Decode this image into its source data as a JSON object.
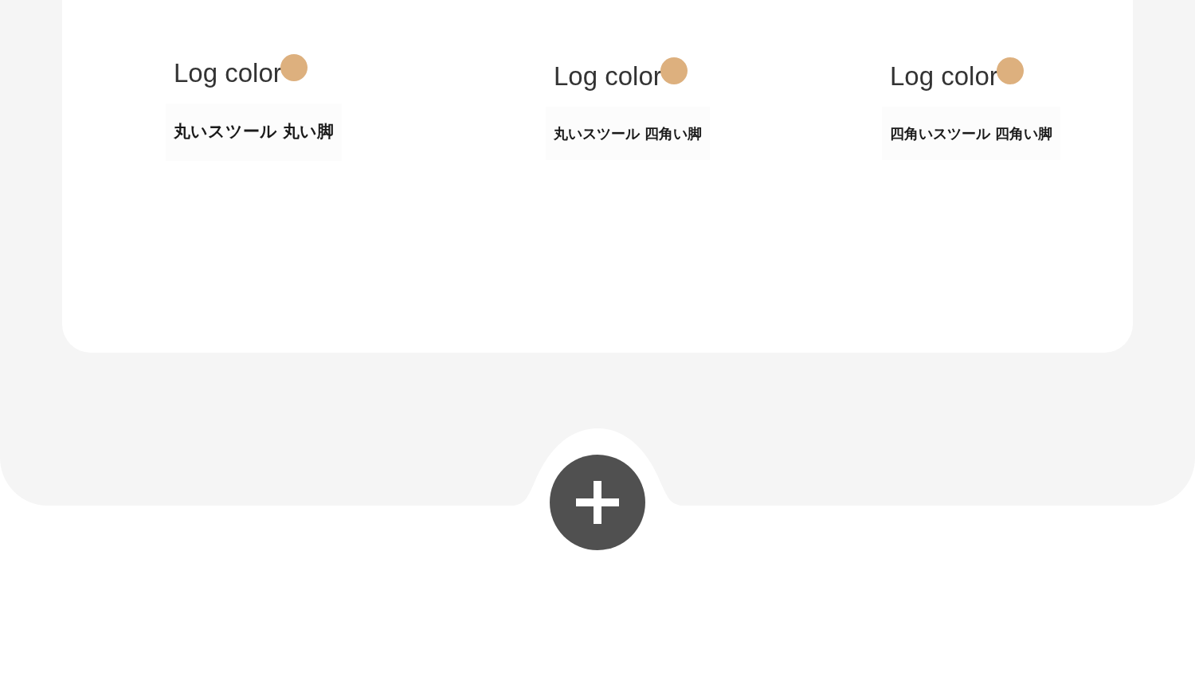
{
  "stools": [
    {
      "color_label": "Log color",
      "color": "#ddb07e",
      "name": "丸いスツール 丸い脚"
    },
    {
      "color_label": "Log color",
      "color": "#ddb07e",
      "name": "丸いスツール 四角い脚"
    },
    {
      "color_label": "Log color",
      "color": "#ddb07e",
      "name": "四角いスツール 四角い脚"
    }
  ]
}
